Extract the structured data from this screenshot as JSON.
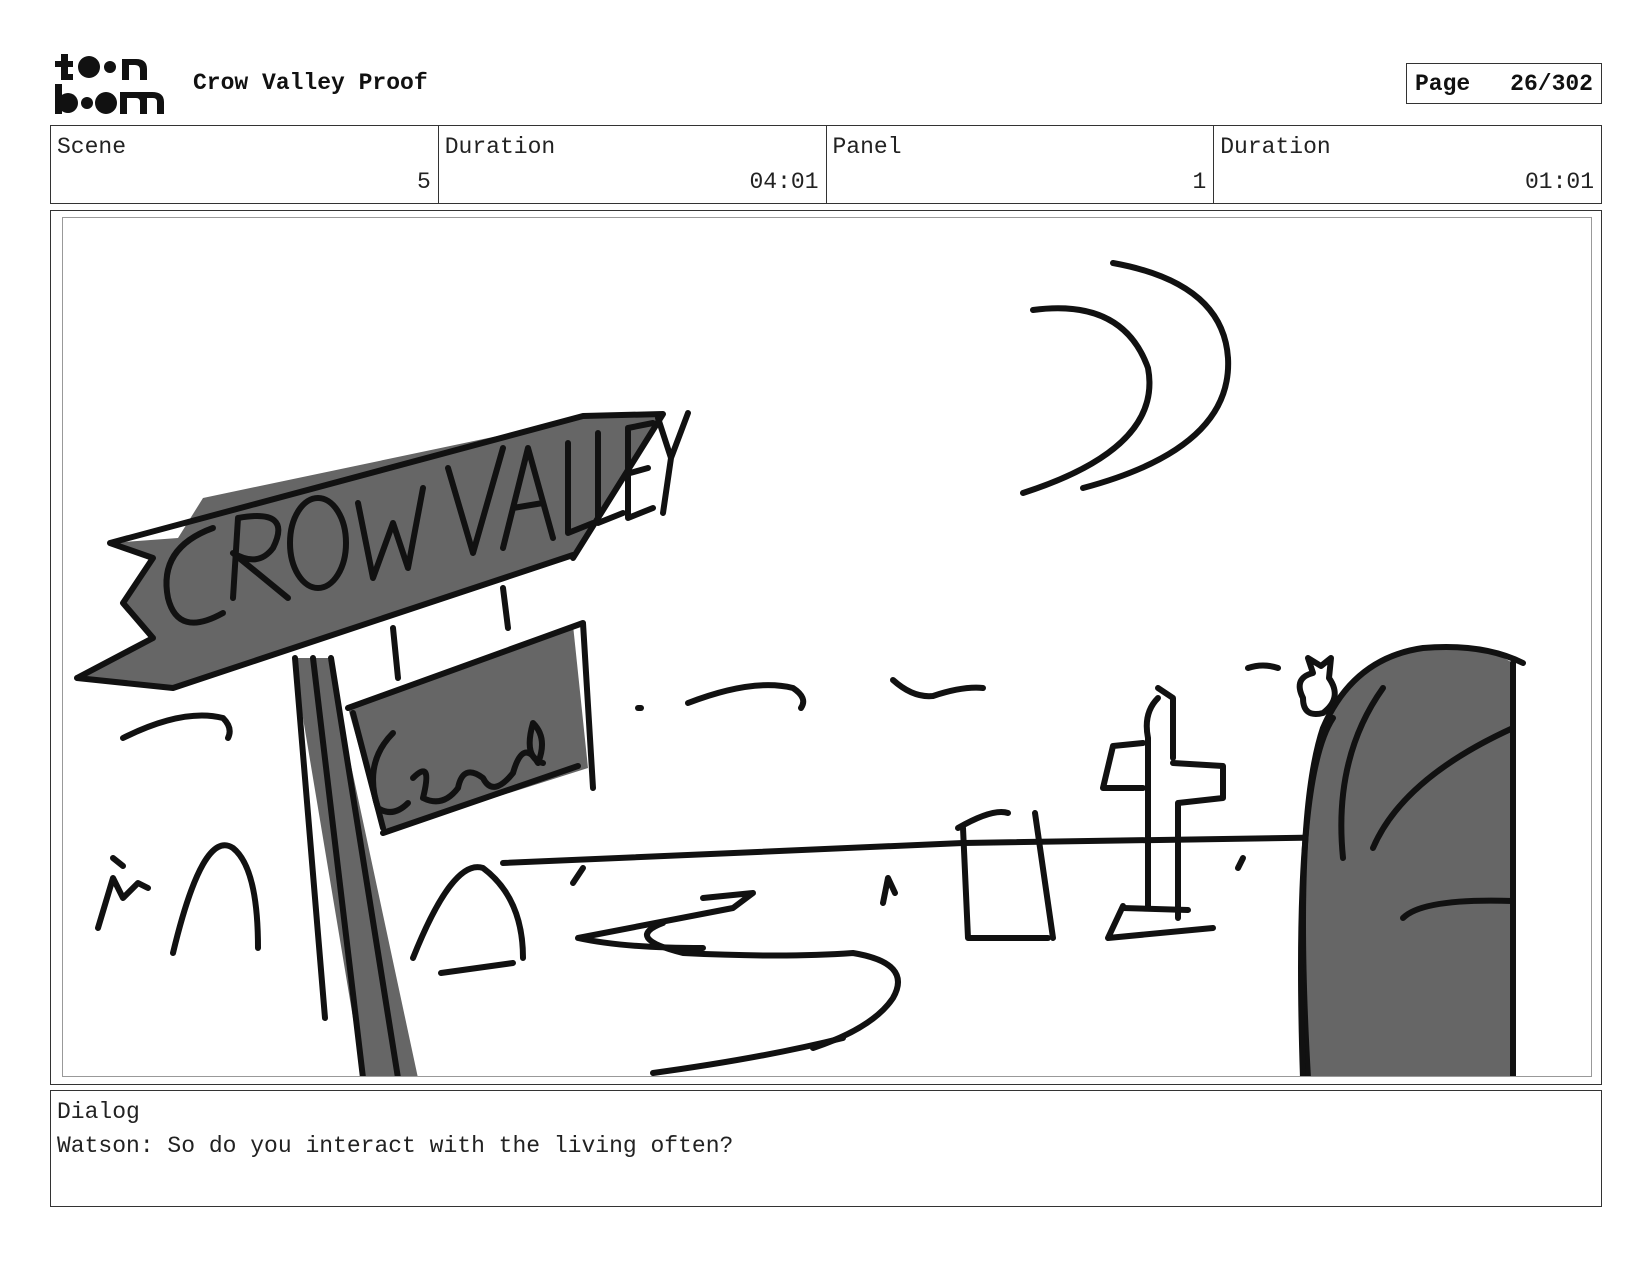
{
  "header": {
    "logo_text_top": "toon",
    "logo_text_bottom": "boom",
    "project_title": "Crow Valley Proof",
    "page_label": "Page",
    "page_number": "26/302"
  },
  "info": {
    "scene_label": "Scene",
    "scene_value": "5",
    "scene_duration_label": "Duration",
    "scene_duration_value": "04:01",
    "panel_label": "Panel",
    "panel_value": "1",
    "panel_duration_label": "Duration",
    "panel_duration_value": "01:01"
  },
  "sketch": {
    "sign_main_text": "CROW VALLEY",
    "sign_sub_text": "Cemetery",
    "ink_color": "#111111",
    "fill_color": "#666666"
  },
  "dialog": {
    "label": "Dialog",
    "text": "Watson: So do you interact with the living often?"
  }
}
